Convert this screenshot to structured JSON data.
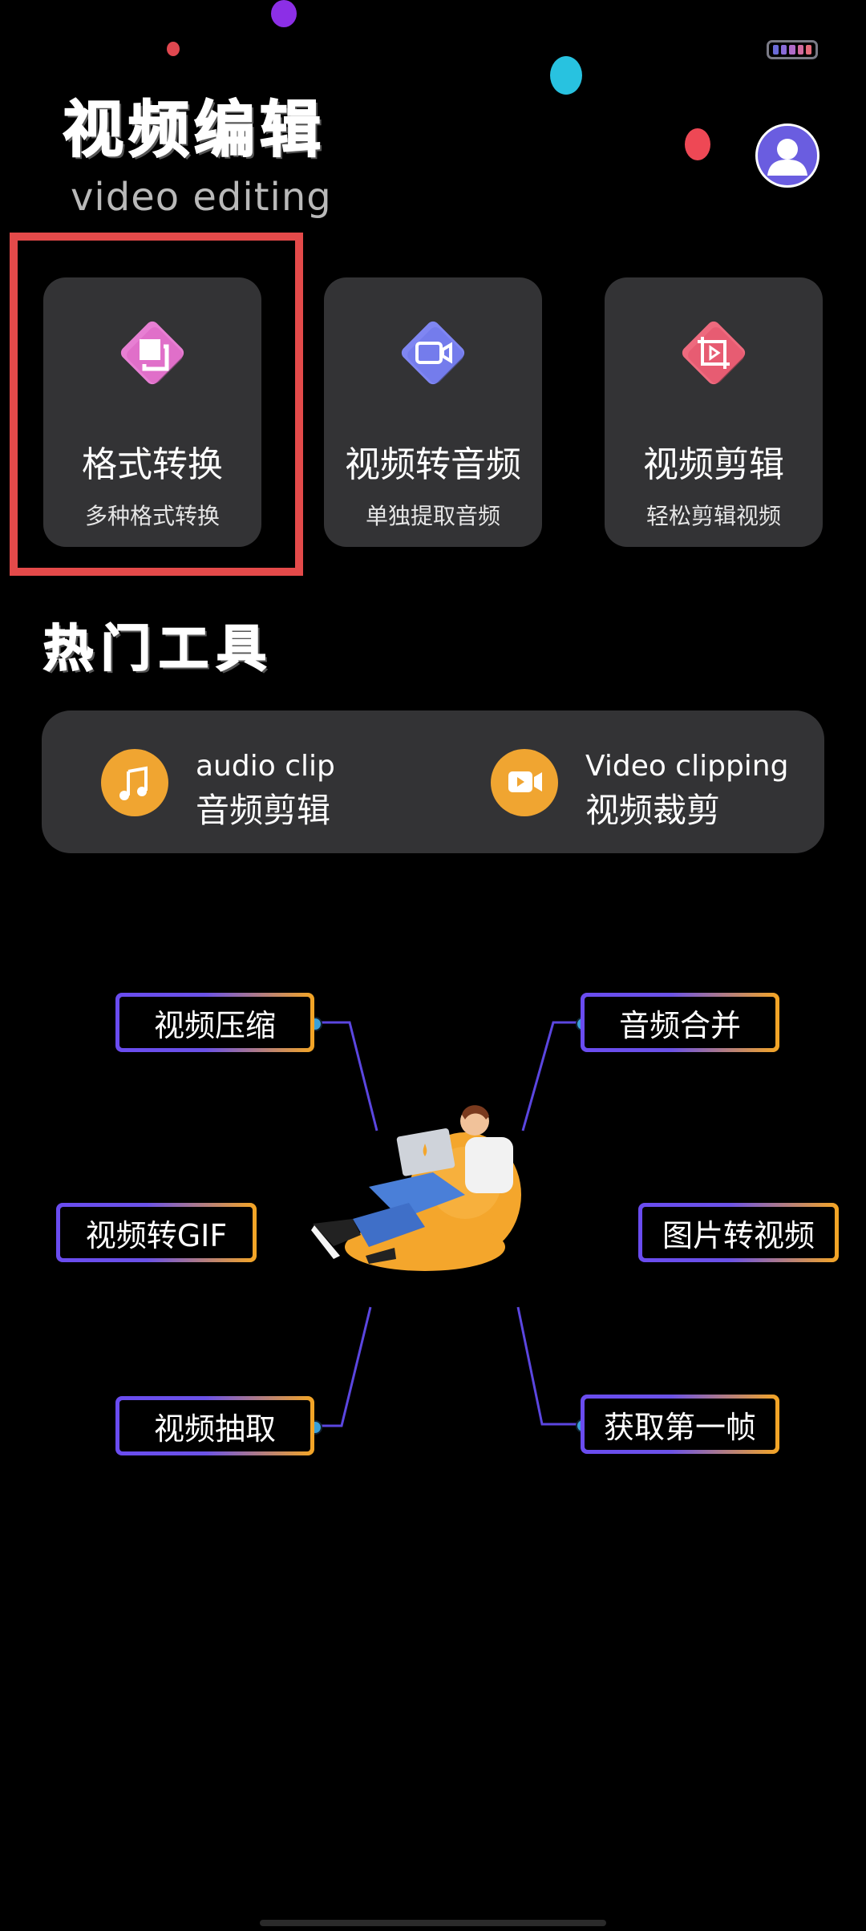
{
  "header": {
    "title_cn": "视频编辑",
    "title_en": "video editing"
  },
  "feature_cards": [
    {
      "label": "格式转换",
      "sub": "多种格式转换",
      "icon": "format-convert-icon",
      "color": "#e77fd3"
    },
    {
      "label": "视频转音频",
      "sub": "单独提取音频",
      "icon": "video-camera-icon",
      "color": "#7f86f2"
    },
    {
      "label": "视频剪辑",
      "sub": "轻松剪辑视频",
      "icon": "crop-play-icon",
      "color": "#ee6a7e"
    }
  ],
  "hot_tools": {
    "title": "热门工具",
    "items": [
      {
        "en": "audio clip",
        "cn": "音频剪辑",
        "icon": "music-note-icon"
      },
      {
        "en": "Video clipping",
        "cn": "视频裁剪",
        "icon": "video-icon"
      }
    ]
  },
  "tool_tags": [
    {
      "label": "视频压缩"
    },
    {
      "label": "音频合并"
    },
    {
      "label": "视频转GIF"
    },
    {
      "label": "图片转视频"
    },
    {
      "label": "视频抽取"
    },
    {
      "label": "获取第一帧"
    }
  ],
  "colors": {
    "background": "#000000",
    "card": "#333335",
    "accent_orange": "#f0a531",
    "highlight_red": "#e44a4a",
    "tag_gradient_start": "#6a4cf0",
    "tag_gradient_end": "#f5a623"
  }
}
